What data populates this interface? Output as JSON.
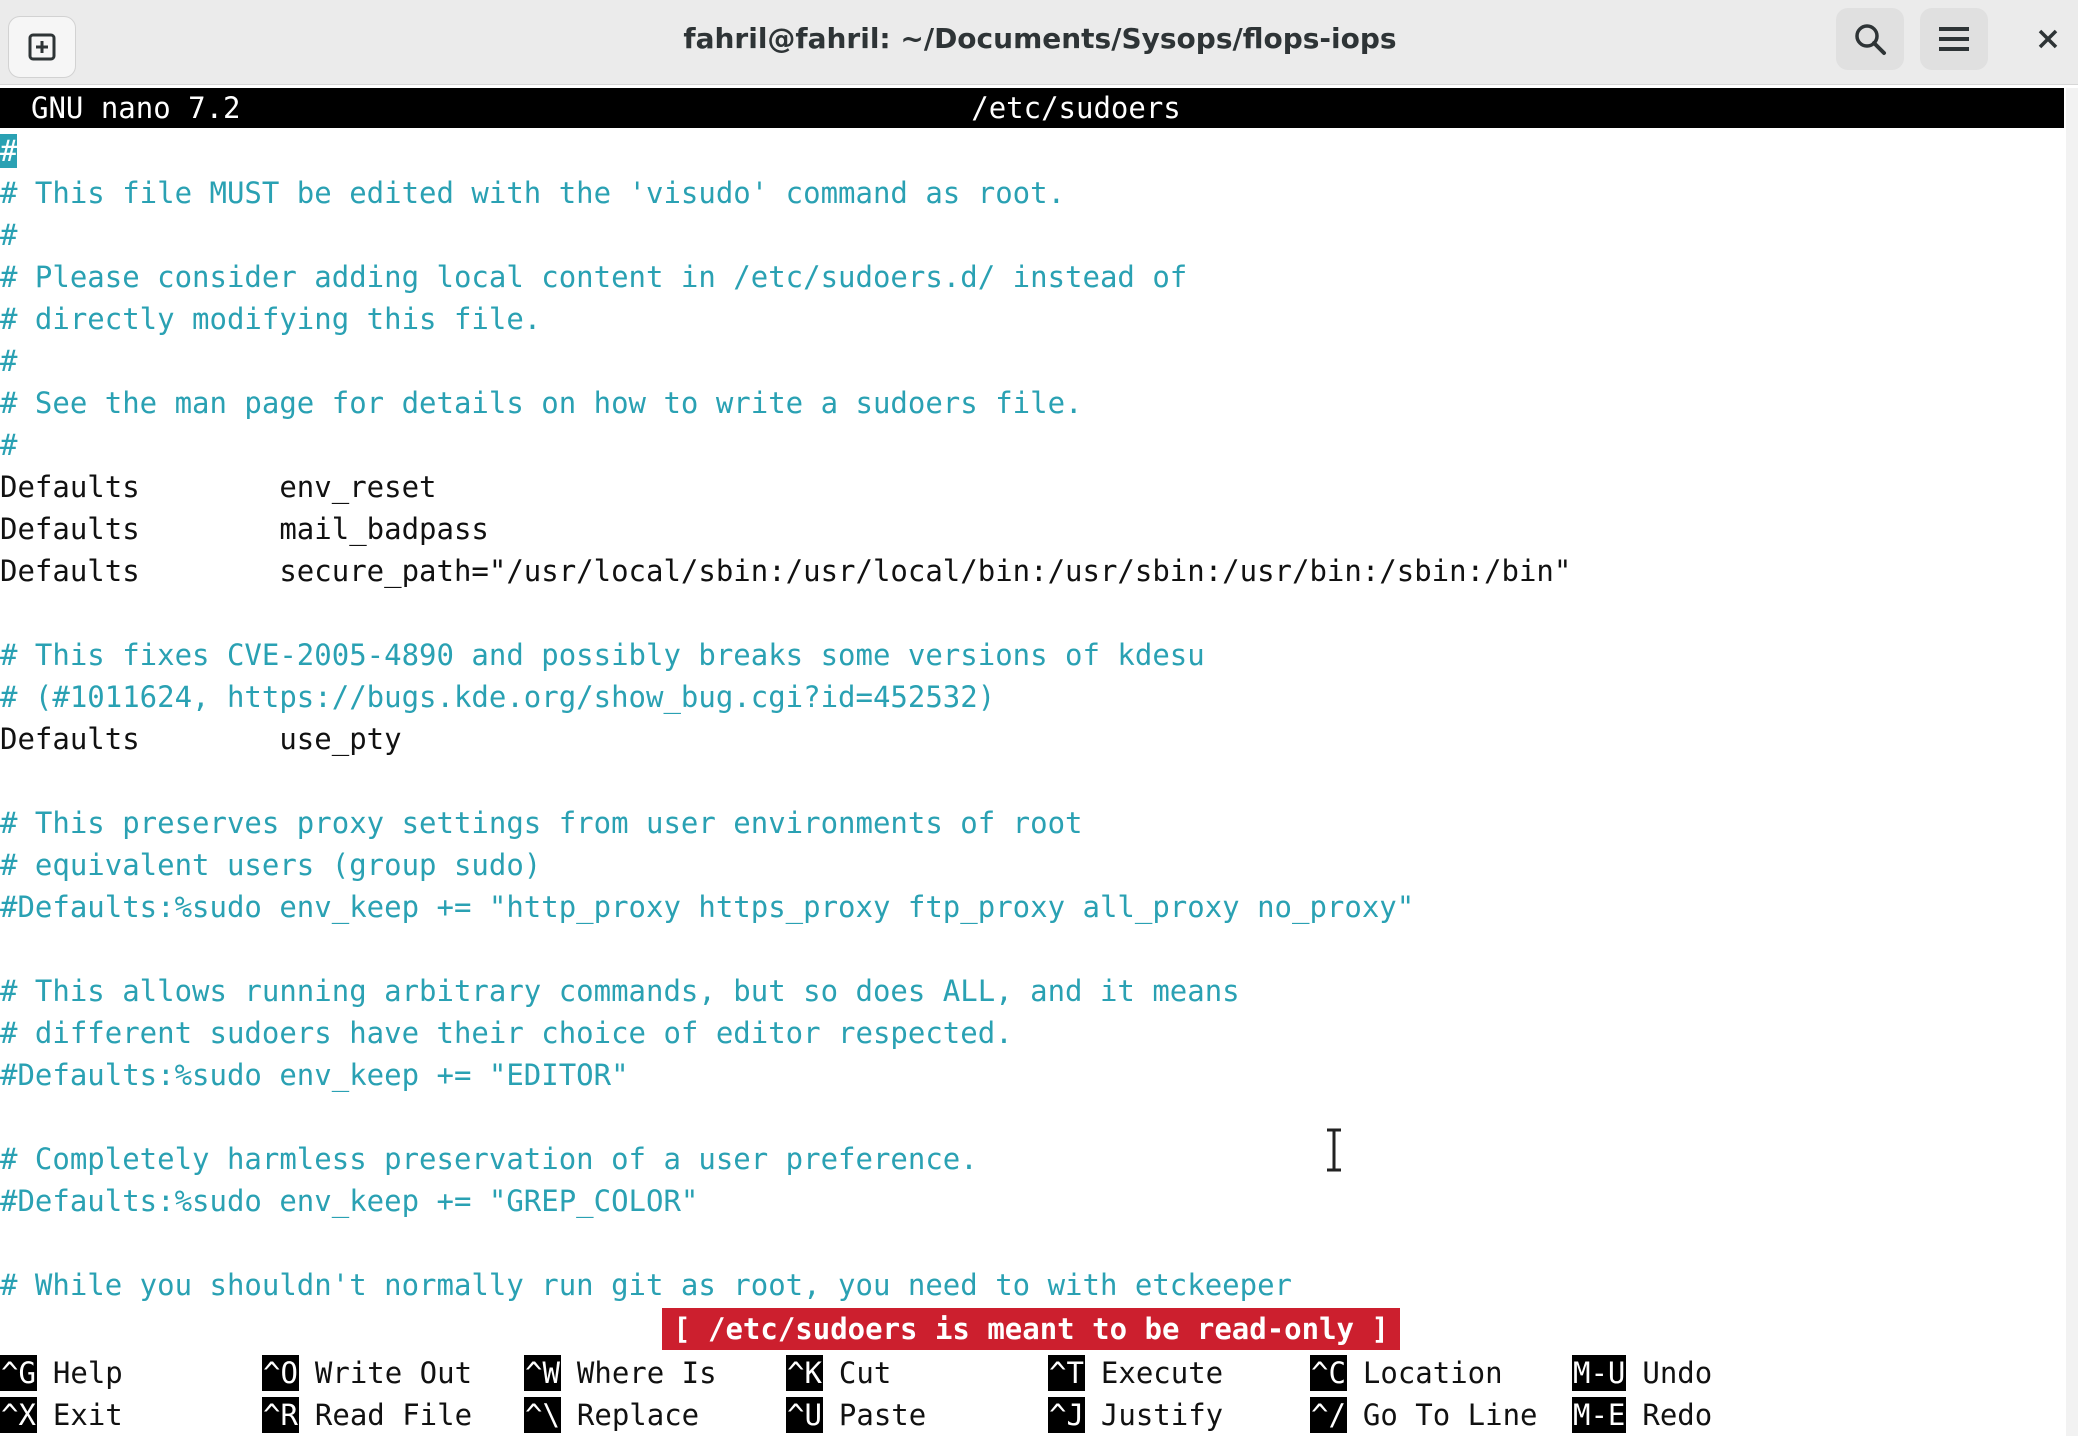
{
  "window": {
    "title": "fahril@fahril: ~/Documents/Sysops/flops-iops",
    "icons": {
      "new_tab": "new-tab-icon",
      "search": "search-icon",
      "menu": "hamburger-menu-icon",
      "close": "close-icon"
    }
  },
  "nano": {
    "version": "GNU nano 7.2",
    "filename": "/etc/sudoers",
    "cursor_char": "#",
    "lines": [
      {
        "text": "",
        "comment": true
      },
      {
        "text": "# This file MUST be edited with the 'visudo' command as root.",
        "comment": true
      },
      {
        "text": "#",
        "comment": true
      },
      {
        "text": "# Please consider adding local content in /etc/sudoers.d/ instead of",
        "comment": true
      },
      {
        "text": "# directly modifying this file.",
        "comment": true
      },
      {
        "text": "#",
        "comment": true
      },
      {
        "text": "# See the man page for details on how to write a sudoers file.",
        "comment": true
      },
      {
        "text": "#",
        "comment": true
      },
      {
        "text": "Defaults\tenv_reset",
        "comment": false
      },
      {
        "text": "Defaults\tmail_badpass",
        "comment": false
      },
      {
        "text": "Defaults\tsecure_path=\"/usr/local/sbin:/usr/local/bin:/usr/sbin:/usr/bin:/sbin:/bin\"",
        "comment": false
      },
      {
        "text": "",
        "comment": false
      },
      {
        "text": "# This fixes CVE-2005-4890 and possibly breaks some versions of kdesu",
        "comment": true
      },
      {
        "text": "# (#1011624, https://bugs.kde.org/show_bug.cgi?id=452532)",
        "comment": true
      },
      {
        "text": "Defaults\tuse_pty",
        "comment": false
      },
      {
        "text": "",
        "comment": false
      },
      {
        "text": "# This preserves proxy settings from user environments of root",
        "comment": true
      },
      {
        "text": "# equivalent users (group sudo)",
        "comment": true
      },
      {
        "text": "#Defaults:%sudo env_keep += \"http_proxy https_proxy ftp_proxy all_proxy no_proxy\"",
        "comment": true
      },
      {
        "text": "",
        "comment": false
      },
      {
        "text": "# This allows running arbitrary commands, but so does ALL, and it means",
        "comment": true
      },
      {
        "text": "# different sudoers have their choice of editor respected.",
        "comment": true
      },
      {
        "text": "#Defaults:%sudo env_keep += \"EDITOR\"",
        "comment": true
      },
      {
        "text": "",
        "comment": false
      },
      {
        "text": "# Completely harmless preservation of a user preference.",
        "comment": true
      },
      {
        "text": "#Defaults:%sudo env_keep += \"GREP_COLOR\"",
        "comment": true
      },
      {
        "text": "",
        "comment": false
      },
      {
        "text": "# While you shouldn't normally run git as root, you need to with etckeeper",
        "comment": true
      }
    ],
    "status_message": "[ /etc/sudoers is meant to be read-only ]",
    "shortcuts": [
      {
        "key": "^G",
        "label": "Help"
      },
      {
        "key": "^O",
        "label": "Write Out"
      },
      {
        "key": "^W",
        "label": "Where Is"
      },
      {
        "key": "^K",
        "label": "Cut"
      },
      {
        "key": "^T",
        "label": "Execute"
      },
      {
        "key": "^C",
        "label": "Location"
      },
      {
        "key": "M-U",
        "label": "Undo"
      },
      {
        "key": "^X",
        "label": "Exit"
      },
      {
        "key": "^R",
        "label": "Read File"
      },
      {
        "key": "^\\",
        "label": "Replace"
      },
      {
        "key": "^U",
        "label": "Paste"
      },
      {
        "key": "^J",
        "label": "Justify"
      },
      {
        "key": "^/",
        "label": "Go To Line"
      },
      {
        "key": "M-E",
        "label": "Redo"
      }
    ],
    "colors": {
      "comment": "#2aa1b3",
      "status_bg": "#cc1f2e",
      "header_bg": "#000000"
    }
  }
}
